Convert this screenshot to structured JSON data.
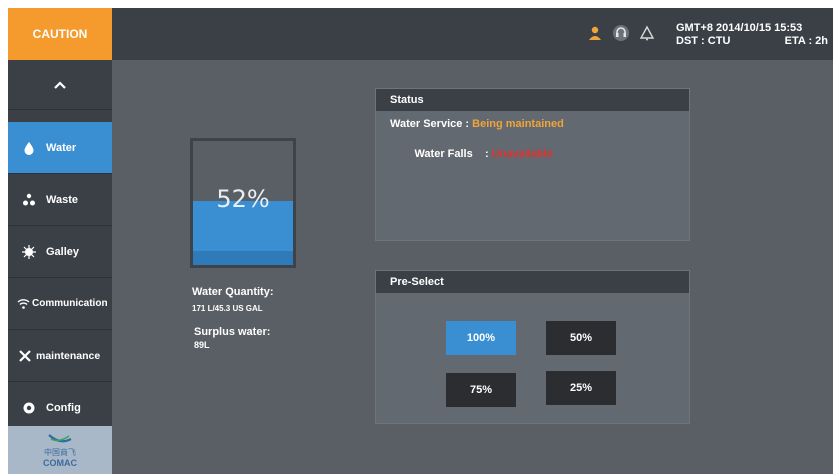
{
  "topbar": {
    "caution_label": "CAUTION",
    "time_line": "GMT+8  2014/10/15  15:53",
    "dst": "DST : CTU",
    "eta": "ETA : 2h",
    "icons": [
      "person-icon",
      "headset-icon",
      "bell-icon"
    ]
  },
  "sidebar": {
    "items": [
      {
        "label": "Water",
        "icon": "water-drop-icon",
        "active": true
      },
      {
        "label": "Waste",
        "icon": "waste-icon"
      },
      {
        "label": "Galley",
        "icon": "galley-icon"
      },
      {
        "label": "Communication",
        "icon": "wifi-icon"
      },
      {
        "label": "maintenance",
        "icon": "wrench-icon"
      },
      {
        "label": "Config",
        "icon": "config-icon"
      }
    ],
    "logo_cn": "中国商飞",
    "logo_en": "COMAC"
  },
  "tank": {
    "level_percent": 52,
    "level_text": "52%",
    "quantity_label": "Water Quantity:",
    "quantity_value": "171 L/45.3 US GAL",
    "surplus_label": "Surplus water:",
    "surplus_value": "89L"
  },
  "status": {
    "title": "Status",
    "service_label": "Water Service : ",
    "service_value": "Being maintained",
    "falls_label": "Water Falls    : ",
    "falls_value": "Unavailable"
  },
  "preselect": {
    "title": "Pre-Select",
    "options": [
      "100%",
      "50%",
      "75%",
      "25%"
    ],
    "selected": "100%"
  },
  "colors": {
    "accent": "#3a8fd3",
    "caution": "#f59a2c",
    "warning_text": "#f1a43a",
    "error_text": "#e0312e"
  }
}
